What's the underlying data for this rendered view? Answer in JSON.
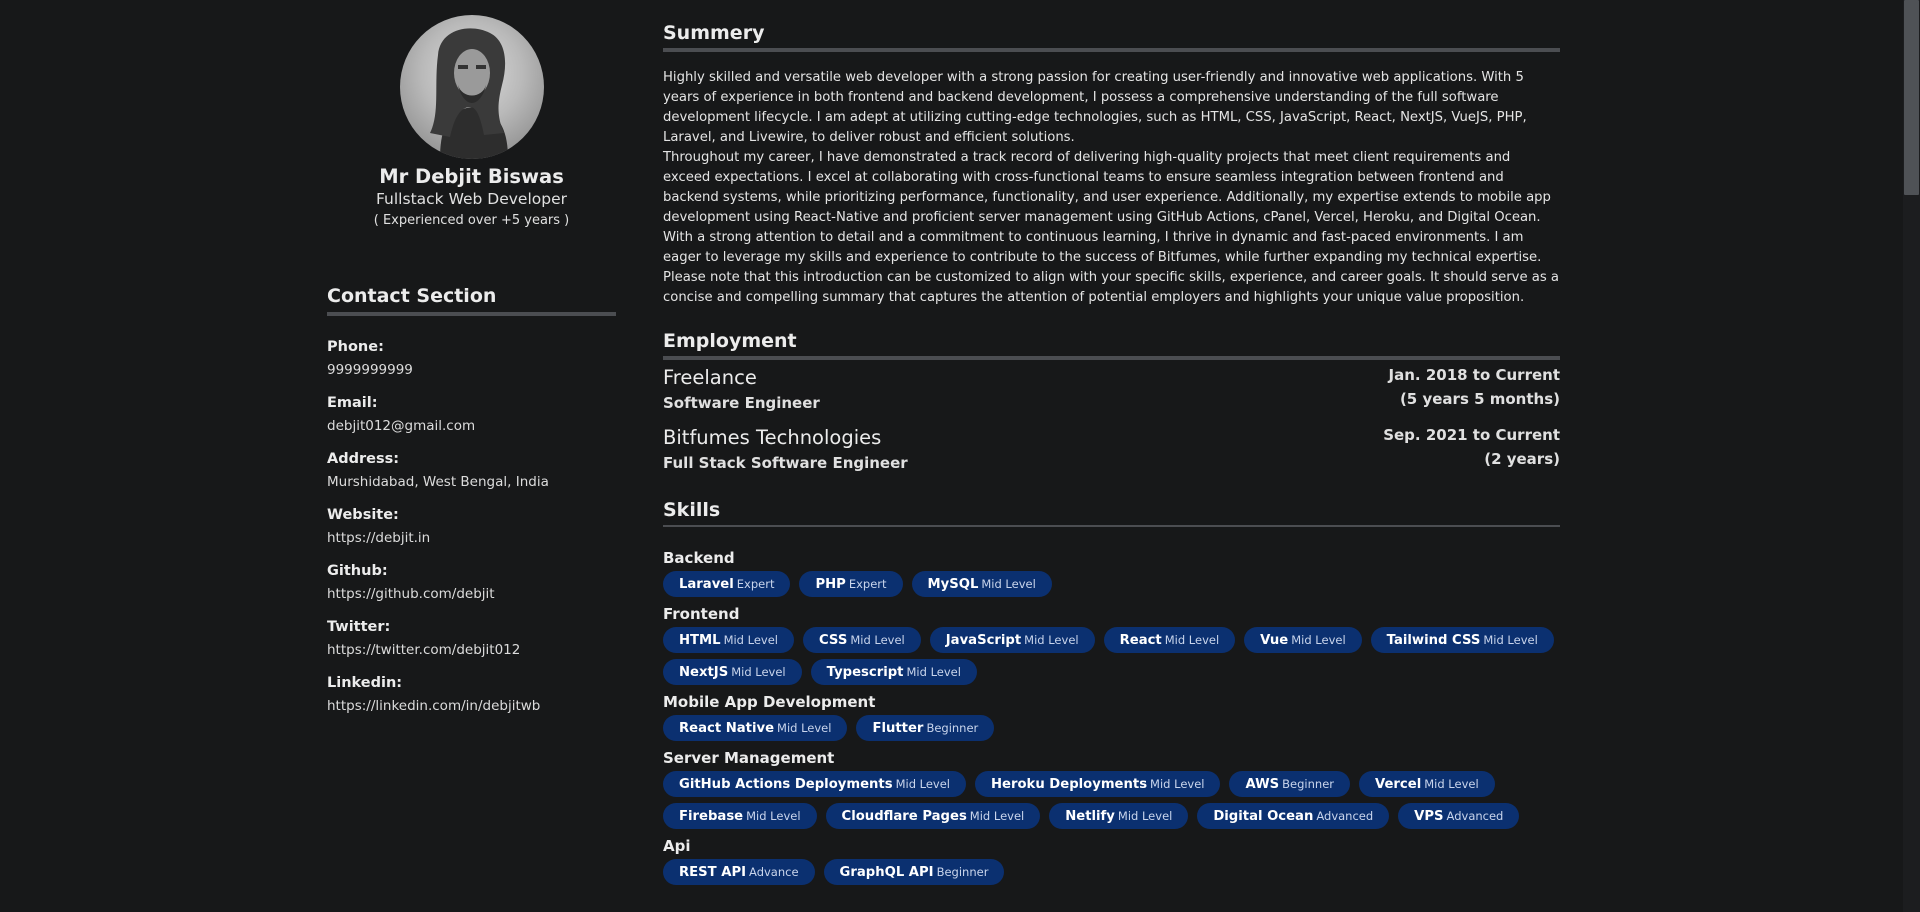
{
  "profile": {
    "name": "Mr Debjit Biswas",
    "role": "Fullstack Web Developer",
    "experience": "( Experienced over +5 years )"
  },
  "contact": {
    "title": "Contact Section",
    "items": [
      {
        "label": "Phone:",
        "value": "9999999999"
      },
      {
        "label": "Email:",
        "value": "debjit012@gmail.com"
      },
      {
        "label": "Address:",
        "value": "Murshidabad, West Bengal, India"
      },
      {
        "label": "Website:",
        "value": "https://debjit.in"
      },
      {
        "label": "Github:",
        "value": "https://github.com/debjit"
      },
      {
        "label": "Twitter:",
        "value": "https://twitter.com/debjit012"
      },
      {
        "label": "Linkedin:",
        "value": "https://linkedin.com/in/debjitwb"
      }
    ]
  },
  "summary": {
    "title": "Summery",
    "paragraphs": [
      "Highly skilled and versatile web developer with a strong passion for creating user-friendly and innovative web applications. With 5 years of experience in both frontend and backend development, I possess a comprehensive understanding of the full software development lifecycle. I am adept at utilizing cutting-edge technologies, such as HTML, CSS, JavaScript, React, NextJS, VueJS, PHP, Laravel, and Livewire, to deliver robust and efficient solutions.",
      "Throughout my career, I have demonstrated a track record of delivering high-quality projects that meet client requirements and exceed expectations. I excel at collaborating with cross-functional teams to ensure seamless integration between frontend and backend systems, while prioritizing performance, functionality, and user experience. Additionally, my expertise extends to mobile app development using React-Native and proficient server management using GitHub Actions, cPanel, Vercel, Heroku, and Digital Ocean.",
      "With a strong attention to detail and a commitment to continuous learning, I thrive in dynamic and fast-paced environments. I am eager to leverage my skills and experience to contribute to the success of Bitfumes, while further expanding my technical expertise.",
      "Please note that this introduction can be customized to align with your specific skills, experience, and career goals. It should serve as a concise and compelling summary that captures the attention of potential employers and highlights your unique value proposition."
    ]
  },
  "employment": {
    "title": "Employment",
    "jobs": [
      {
        "company": "Freelance",
        "title": "Software Engineer",
        "period": "Jan. 2018 to Current",
        "duration": "(5 years 5 months)"
      },
      {
        "company": "Bitfumes Technologies",
        "title": "Full Stack Software Engineer",
        "period": "Sep. 2021 to Current",
        "duration": "(2 years)"
      }
    ]
  },
  "skills": {
    "title": "Skills",
    "groups": [
      {
        "name": "Backend",
        "items": [
          {
            "name": "Laravel",
            "level": "Expert"
          },
          {
            "name": "PHP",
            "level": "Expert"
          },
          {
            "name": "MySQL",
            "level": "Mid Level"
          }
        ]
      },
      {
        "name": "Frontend",
        "items": [
          {
            "name": "HTML",
            "level": "Mid Level"
          },
          {
            "name": "CSS",
            "level": "Mid Level"
          },
          {
            "name": "JavaScript",
            "level": "Mid Level"
          },
          {
            "name": "React",
            "level": "Mid Level"
          },
          {
            "name": "Vue",
            "level": "Mid Level"
          },
          {
            "name": "Tailwind CSS",
            "level": "Mid Level"
          },
          {
            "name": "NextJS",
            "level": "Mid Level"
          },
          {
            "name": "Typescript",
            "level": "Mid Level"
          }
        ]
      },
      {
        "name": "Mobile App Development",
        "items": [
          {
            "name": "React Native",
            "level": "Mid Level"
          },
          {
            "name": "Flutter",
            "level": "Beginner"
          }
        ]
      },
      {
        "name": "Server Management",
        "items": [
          {
            "name": "GitHub Actions Deployments",
            "level": "Mid Level"
          },
          {
            "name": "Heroku Deployments",
            "level": "Mid Level"
          },
          {
            "name": "AWS",
            "level": "Beginner"
          },
          {
            "name": "Vercel",
            "level": "Mid Level"
          },
          {
            "name": "Firebase",
            "level": "Mid Level"
          },
          {
            "name": "Cloudflare Pages",
            "level": "Mid Level"
          },
          {
            "name": "Netlify",
            "level": "Mid Level"
          },
          {
            "name": "Digital Ocean",
            "level": "Advanced"
          },
          {
            "name": "VPS",
            "level": "Advanced"
          }
        ]
      },
      {
        "name": "Api",
        "items": [
          {
            "name": "REST API",
            "level": "Advance"
          },
          {
            "name": "GraphQL API",
            "level": "Beginner"
          }
        ]
      }
    ]
  },
  "colors": {
    "background": "#171819",
    "chip": "#0b3070",
    "divider": "#4b4d51"
  }
}
